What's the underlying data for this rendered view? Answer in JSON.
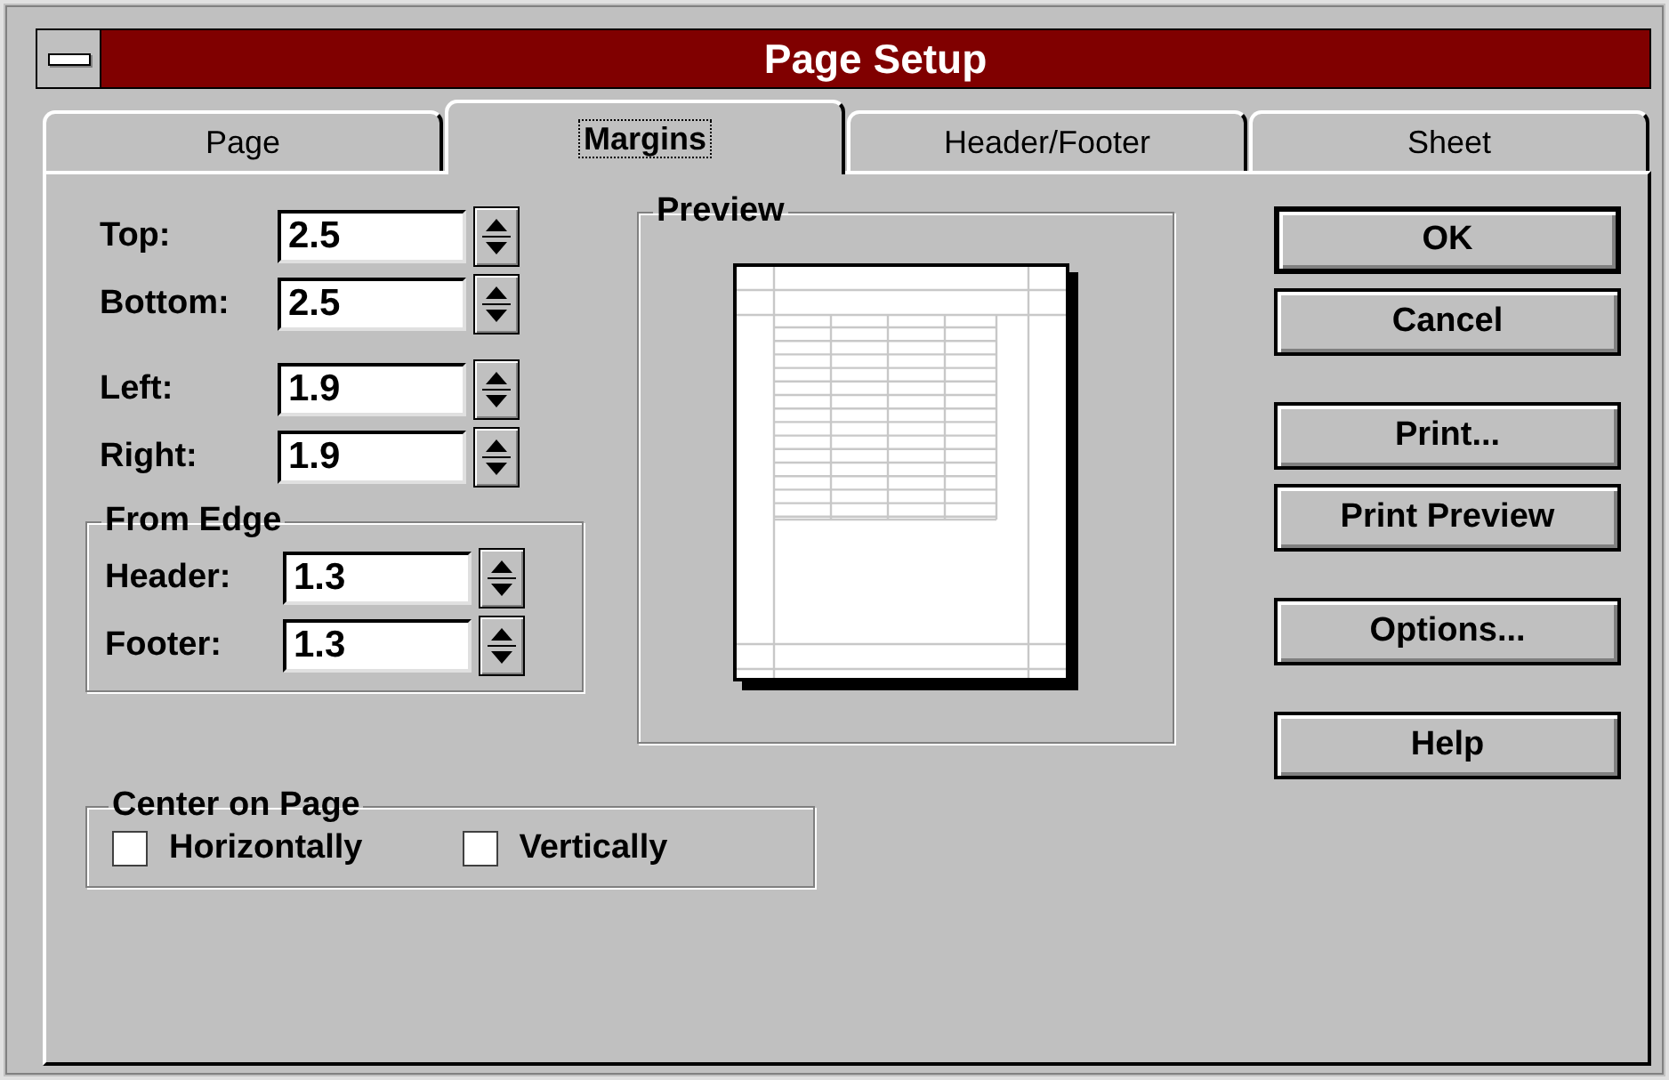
{
  "window": {
    "title": "Page Setup"
  },
  "tabs": [
    {
      "label": "Page",
      "selected": false
    },
    {
      "label": "Margins",
      "selected": true
    },
    {
      "label": "Header/Footer",
      "selected": false
    },
    {
      "label": "Sheet",
      "selected": false
    }
  ],
  "margin_groups": [
    {
      "fields": [
        {
          "label": "Top:",
          "value": "2.5"
        },
        {
          "label": "Bottom:",
          "value": "2.5"
        }
      ]
    },
    {
      "fields": [
        {
          "label": "Left:",
          "value": "1.9"
        },
        {
          "label": "Right:",
          "value": "1.9"
        }
      ]
    }
  ],
  "from_edge": {
    "title": "From Edge",
    "fields": [
      {
        "label": "Header:",
        "value": "1.3"
      },
      {
        "label": "Footer:",
        "value": "1.3"
      }
    ]
  },
  "preview": {
    "title": "Preview"
  },
  "center_on_page": {
    "title": "Center on Page",
    "options": [
      {
        "label": "Horizontally",
        "checked": false
      },
      {
        "label": "Vertically",
        "checked": false
      }
    ]
  },
  "button_groups": [
    {
      "buttons": [
        {
          "label": "OK",
          "default": true
        },
        {
          "label": "Cancel",
          "default": false
        }
      ]
    },
    {
      "buttons": [
        {
          "label": "Print...",
          "default": false
        },
        {
          "label": "Print Preview",
          "default": false
        }
      ]
    },
    {
      "buttons": [
        {
          "label": "Options...",
          "default": false
        }
      ]
    },
    {
      "buttons": [
        {
          "label": "Help",
          "default": false
        }
      ]
    }
  ]
}
